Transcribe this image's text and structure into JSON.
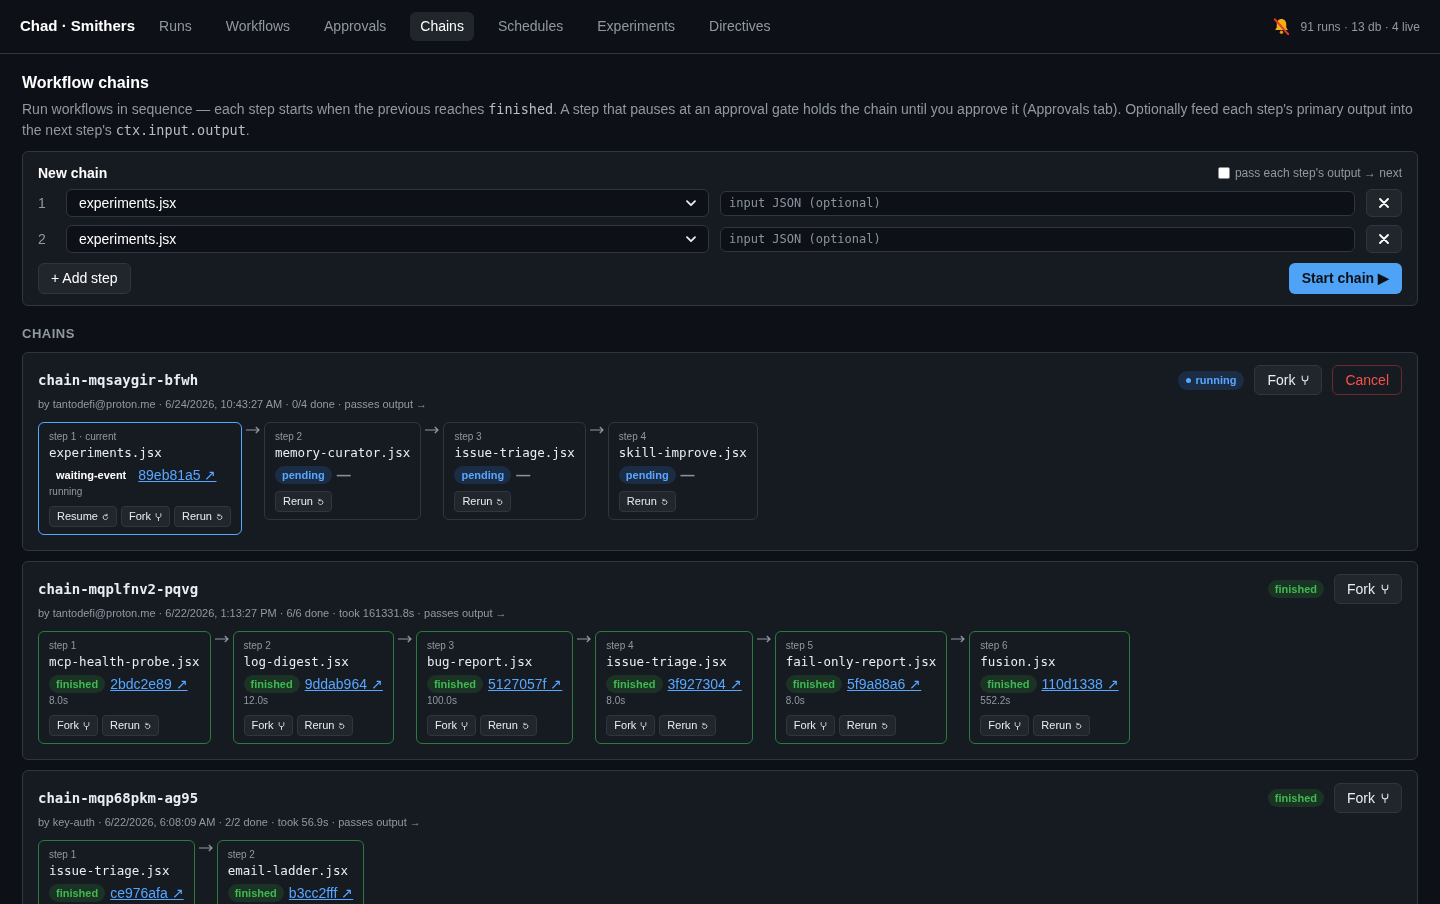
{
  "nav": {
    "brand": "Chad · Smithers",
    "tabs": [
      {
        "label": "Runs",
        "selected": false
      },
      {
        "label": "Workflows",
        "selected": false
      },
      {
        "label": "Approvals",
        "selected": false
      },
      {
        "label": "Chains",
        "selected": true
      },
      {
        "label": "Schedules",
        "selected": false
      },
      {
        "label": "Experiments",
        "selected": false
      },
      {
        "label": "Directives",
        "selected": false
      }
    ],
    "stats": "91 runs · 13 db · 4 live"
  },
  "page": {
    "title": "Workflow chains",
    "description": [
      {
        "text": "Run workflows in sequence — each step starts when the previous reaches ",
        "kind": "text"
      },
      {
        "text": "finished",
        "kind": "code"
      },
      {
        "text": ". A step that pauses at an approval gate holds the chain until you approve it (Approvals tab). Optionally feed each step's primary output into the next step's ",
        "kind": "text"
      },
      {
        "text": "ctx.input.output",
        "kind": "code"
      },
      {
        "text": ".",
        "kind": "text"
      }
    ]
  },
  "new_chain": {
    "title": "New chain",
    "pass_output": {
      "label": "pass each step's output → next",
      "checked": false
    },
    "steps": [
      {
        "number": "1",
        "workflow": "experiments.jsx",
        "input_placeholder": "input JSON (optional)"
      },
      {
        "number": "2",
        "workflow": "experiments.jsx",
        "input_placeholder": "input JSON (optional)"
      }
    ],
    "add_button": "+ Add step",
    "start_button": "Start chain ▶"
  },
  "chains_heading": "CHAINS",
  "chains": [
    {
      "name": "chain-mqsaygir-bfwh",
      "meta": "by tantodefi@proton.me · 6/24/2026, 10:43:27 AM · 0/4 done · passes output →",
      "status": {
        "label": "running",
        "kind": "running"
      },
      "actions": [
        {
          "label": "Fork",
          "kind": "fork"
        },
        {
          "label": "Cancel",
          "kind": "cancel"
        }
      ],
      "steps": [
        {
          "label": "step 1 · current",
          "current": true,
          "workflow": "experiments.jsx",
          "status": {
            "label": "waiting-event",
            "kind": "waiting"
          },
          "run": {
            "text": "89eb81a5 ↗",
            "kind": "link"
          },
          "detail": "running",
          "buttons": [
            {
              "label": "Resume",
              "kind": "resume"
            },
            {
              "label": "Fork",
              "kind": "fork"
            },
            {
              "label": "Rerun",
              "kind": "rerun"
            }
          ]
        },
        {
          "label": "step 2",
          "current": false,
          "workflow": "memory-curator.jsx",
          "status": {
            "label": "pending",
            "kind": "pending"
          },
          "run": {
            "text": "—",
            "kind": "none"
          },
          "buttons": [
            {
              "label": "Rerun",
              "kind": "rerun"
            }
          ]
        },
        {
          "label": "step 3",
          "current": false,
          "workflow": "issue-triage.jsx",
          "status": {
            "label": "pending",
            "kind": "pending"
          },
          "run": {
            "text": "—",
            "kind": "none"
          },
          "buttons": [
            {
              "label": "Rerun",
              "kind": "rerun"
            }
          ]
        },
        {
          "label": "step 4",
          "current": false,
          "workflow": "skill-improve.jsx",
          "status": {
            "label": "pending",
            "kind": "pending"
          },
          "run": {
            "text": "—",
            "kind": "none"
          },
          "buttons": [
            {
              "label": "Rerun",
              "kind": "rerun"
            }
          ]
        }
      ]
    },
    {
      "name": "chain-mqplfnv2-pqvg",
      "meta": "by tantodefi@proton.me · 6/22/2026, 1:13:27 PM · 6/6 done · took 161331.8s · passes output →",
      "status": {
        "label": "finished",
        "kind": "finished"
      },
      "actions": [
        {
          "label": "Fork",
          "kind": "fork"
        }
      ],
      "steps": [
        {
          "label": "step 1",
          "current": false,
          "workflow": "mcp-health-probe.jsx",
          "status": {
            "label": "finished",
            "kind": "finished"
          },
          "run": {
            "text": "2bdc2e89 ↗",
            "kind": "link"
          },
          "detail": "8.0s",
          "buttons": [
            {
              "label": "Fork",
              "kind": "fork"
            },
            {
              "label": "Rerun",
              "kind": "rerun"
            }
          ]
        },
        {
          "label": "step 2",
          "current": false,
          "workflow": "log-digest.jsx",
          "status": {
            "label": "finished",
            "kind": "finished"
          },
          "run": {
            "text": "9ddab964 ↗",
            "kind": "link"
          },
          "detail": "12.0s",
          "buttons": [
            {
              "label": "Fork",
              "kind": "fork"
            },
            {
              "label": "Rerun",
              "kind": "rerun"
            }
          ]
        },
        {
          "label": "step 3",
          "current": false,
          "workflow": "bug-report.jsx",
          "status": {
            "label": "finished",
            "kind": "finished"
          },
          "run": {
            "text": "5127057f ↗",
            "kind": "link"
          },
          "detail": "100.0s",
          "buttons": [
            {
              "label": "Fork",
              "kind": "fork"
            },
            {
              "label": "Rerun",
              "kind": "rerun"
            }
          ]
        },
        {
          "label": "step 4",
          "current": false,
          "workflow": "issue-triage.jsx",
          "status": {
            "label": "finished",
            "kind": "finished"
          },
          "run": {
            "text": "3f927304 ↗",
            "kind": "link"
          },
          "detail": "8.0s",
          "buttons": [
            {
              "label": "Fork",
              "kind": "fork"
            },
            {
              "label": "Rerun",
              "kind": "rerun"
            }
          ]
        },
        {
          "label": "step 5",
          "current": false,
          "workflow": "fail-only-report.jsx",
          "status": {
            "label": "finished",
            "kind": "finished"
          },
          "run": {
            "text": "5f9a88a6 ↗",
            "kind": "link"
          },
          "detail": "8.0s",
          "buttons": [
            {
              "label": "Fork",
              "kind": "fork"
            },
            {
              "label": "Rerun",
              "kind": "rerun"
            }
          ]
        },
        {
          "label": "step 6",
          "current": false,
          "workflow": "fusion.jsx",
          "status": {
            "label": "finished",
            "kind": "finished"
          },
          "run": {
            "text": "110d1338 ↗",
            "kind": "link"
          },
          "detail": "552.2s",
          "buttons": [
            {
              "label": "Fork",
              "kind": "fork"
            },
            {
              "label": "Rerun",
              "kind": "rerun"
            }
          ]
        }
      ]
    },
    {
      "name": "chain-mqp68pkm-ag95",
      "meta": "by key-auth · 6/22/2026, 6:08:09 AM · 2/2 done · took 56.9s · passes output →",
      "status": {
        "label": "finished",
        "kind": "finished"
      },
      "actions": [
        {
          "label": "Fork",
          "kind": "fork"
        }
      ],
      "steps": [
        {
          "label": "step 1",
          "current": false,
          "workflow": "issue-triage.jsx",
          "status": {
            "label": "finished",
            "kind": "finished"
          },
          "run": {
            "text": "ce976afa ↗",
            "kind": "link"
          }
        },
        {
          "label": "step 2",
          "current": false,
          "workflow": "email-ladder.jsx",
          "status": {
            "label": "finished",
            "kind": "finished"
          },
          "run": {
            "text": "b3cc2fff ↗",
            "kind": "link"
          }
        }
      ]
    }
  ]
}
